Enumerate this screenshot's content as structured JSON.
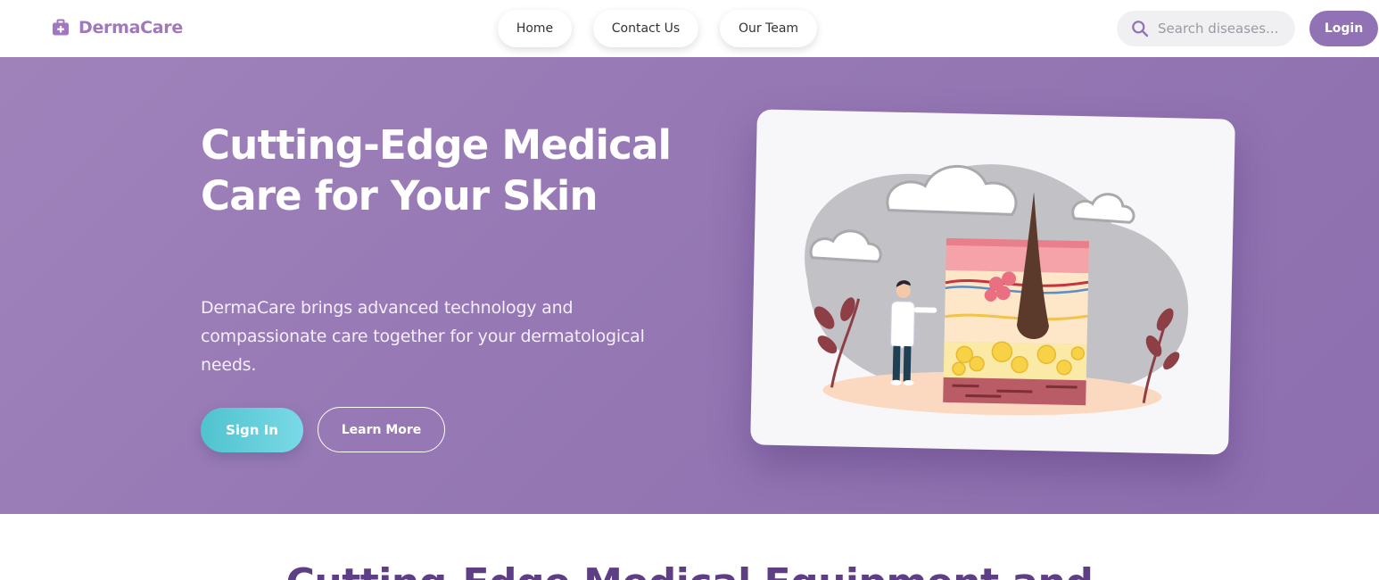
{
  "brand": {
    "name": "DermaCare",
    "icon": "medical-kit-icon",
    "color": "#9f78bd"
  },
  "nav": [
    {
      "label": "Home"
    },
    {
      "label": "Contact Us"
    },
    {
      "label": "Our Team"
    }
  ],
  "search": {
    "placeholder": "Search diseases...",
    "icon": "search-icon"
  },
  "header_login_label": "Login",
  "hero": {
    "title": "Cutting-Edge Medical Care for Your Skin",
    "description": "DermaCare brings advanced technology and compassionate care together for your dermatological needs.",
    "primary_button": "Sign In",
    "secondary_button": "Learn More",
    "illustration": "skin-layers-doctor-illustration"
  },
  "next_section": {
    "title": "Cutting-Edge Medical Equipment and"
  },
  "colors": {
    "accent": "#9072b5",
    "hero_background": "#9779b5",
    "cta_teal": "#5fcbd8",
    "section_heading": "#5e3e85"
  }
}
